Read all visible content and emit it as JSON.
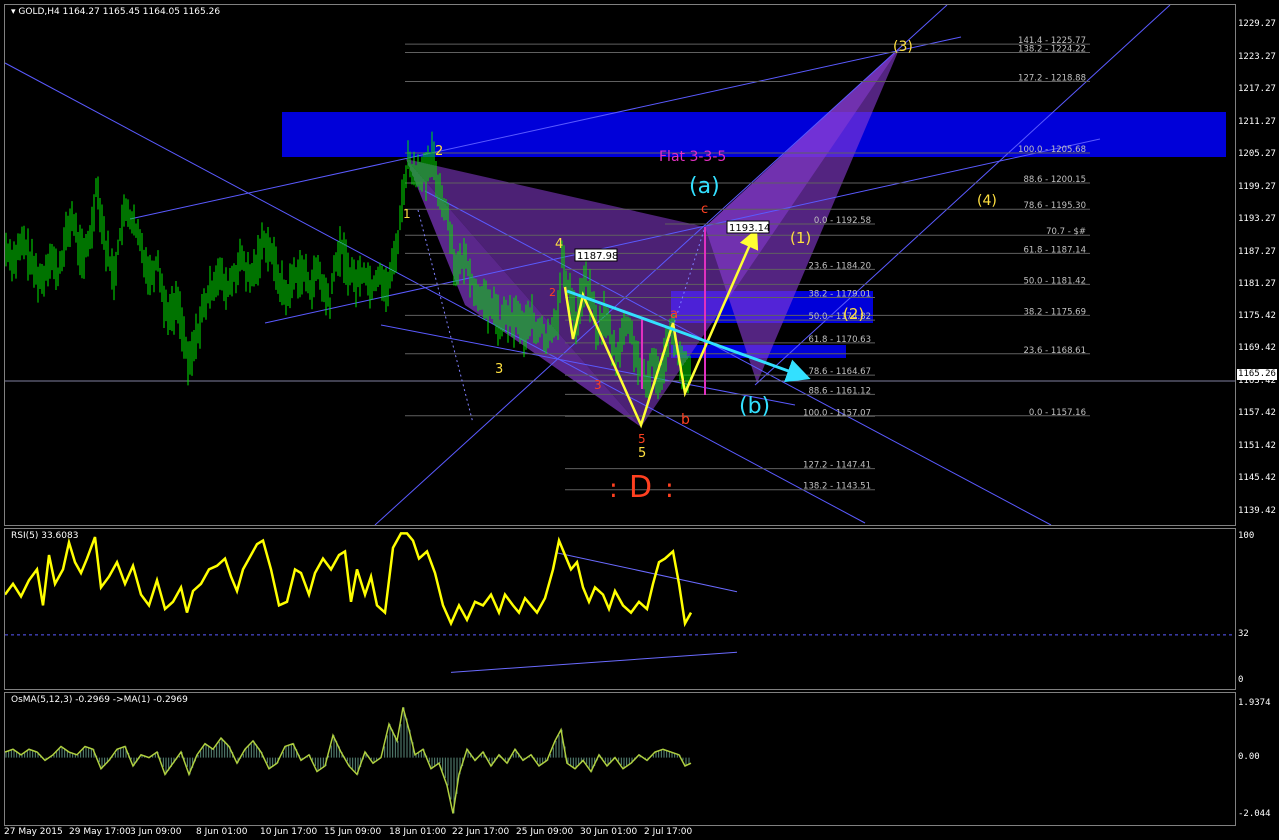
{
  "symbol_header": "GOLD,H4  1164.27 1165.45 1164.05 1165.26",
  "rsi_header": "RSI(5) 33.6083",
  "osma_header": "OsMA(5,12,3) -0.2969  ->MA(1) -0.2969",
  "current_price": "1165.26",
  "chart_data": [
    {
      "type": "candlestick",
      "title": "GOLD,H4",
      "ylim": [
        1137,
        1233
      ],
      "y_ticks": [
        "1229.27",
        "1223.27",
        "1217.27",
        "1211.27",
        "1205.27",
        "1199.27",
        "1193.27",
        "1187.27",
        "1181.27",
        "1175.42",
        "1169.42",
        "1163.42",
        "1157.42",
        "1151.42",
        "1145.42",
        "1139.42"
      ],
      "x_ticks": [
        "27 May 2015",
        "29 May 17:00",
        "3 Jun 09:00",
        "8 Jun 01:00",
        "10 Jun 17:00",
        "15 Jun 09:00",
        "18 Jun 01:00",
        "22 Jun 17:00",
        "25 Jun 09:00",
        "30 Jun 01:00",
        "2 Jul 17:00"
      ],
      "close_path": [
        [
          0,
          1188
        ],
        [
          8,
          1186
        ],
        [
          18,
          1189
        ],
        [
          28,
          1184
        ],
        [
          36,
          1182
        ],
        [
          44,
          1187
        ],
        [
          52,
          1183
        ],
        [
          60,
          1190
        ],
        [
          66,
          1194
        ],
        [
          72,
          1189
        ],
        [
          78,
          1186
        ],
        [
          86,
          1192
        ],
        [
          90,
          1200
        ],
        [
          94,
          1196
        ],
        [
          100,
          1188
        ],
        [
          108,
          1183
        ],
        [
          116,
          1193
        ],
        [
          122,
          1195
        ],
        [
          128,
          1192
        ],
        [
          136,
          1188
        ],
        [
          144,
          1183
        ],
        [
          152,
          1186
        ],
        [
          158,
          1178
        ],
        [
          164,
          1176
        ],
        [
          172,
          1178
        ],
        [
          178,
          1172
        ],
        [
          182,
          1166
        ],
        [
          188,
          1170
        ],
        [
          196,
          1176
        ],
        [
          204,
          1180
        ],
        [
          212,
          1184
        ],
        [
          220,
          1180
        ],
        [
          228,
          1183
        ],
        [
          236,
          1186
        ],
        [
          244,
          1182
        ],
        [
          252,
          1186
        ],
        [
          258,
          1190
        ],
        [
          264,
          1188
        ],
        [
          272,
          1183
        ],
        [
          280,
          1179
        ],
        [
          288,
          1183
        ],
        [
          296,
          1184
        ],
        [
          304,
          1181
        ],
        [
          312,
          1184
        ],
        [
          318,
          1180
        ],
        [
          324,
          1178
        ],
        [
          330,
          1186
        ],
        [
          336,
          1188
        ],
        [
          342,
          1184
        ],
        [
          350,
          1182
        ],
        [
          358,
          1184
        ],
        [
          366,
          1181
        ],
        [
          374,
          1184
        ],
        [
          380,
          1180
        ],
        [
          386,
          1184
        ],
        [
          392,
          1190
        ],
        [
          398,
          1200
        ],
        [
          402,
          1204
        ],
        [
          408,
          1202
        ],
        [
          414,
          1203
        ],
        [
          420,
          1201
        ],
        [
          426,
          1205
        ],
        [
          432,
          1200
        ],
        [
          438,
          1196
        ],
        [
          444,
          1192
        ],
        [
          448,
          1186
        ],
        [
          452,
          1184
        ],
        [
          458,
          1186
        ],
        [
          464,
          1184
        ],
        [
          470,
          1179
        ],
        [
          476,
          1180
        ],
        [
          482,
          1176
        ],
        [
          488,
          1178
        ],
        [
          494,
          1173
        ],
        [
          500,
          1176
        ],
        [
          506,
          1174
        ],
        [
          512,
          1176
        ],
        [
          518,
          1172
        ],
        [
          524,
          1176
        ],
        [
          530,
          1172
        ],
        [
          536,
          1174
        ],
        [
          540,
          1170
        ],
        [
          546,
          1174
        ],
        [
          552,
          1176
        ],
        [
          556,
          1186
        ],
        [
          560,
          1182
        ],
        [
          566,
          1179
        ],
        [
          570,
          1174
        ],
        [
          576,
          1180
        ],
        [
          580,
          1182
        ],
        [
          586,
          1178
        ],
        [
          592,
          1172
        ],
        [
          598,
          1176
        ],
        [
          604,
          1172
        ],
        [
          610,
          1168
        ],
        [
          616,
          1172
        ],
        [
          622,
          1174
        ],
        [
          628,
          1170
        ],
        [
          634,
          1166
        ],
        [
          640,
          1162
        ],
        [
          646,
          1168
        ],
        [
          652,
          1164
        ],
        [
          658,
          1168
        ],
        [
          664,
          1174
        ],
        [
          670,
          1170
        ],
        [
          676,
          1166
        ],
        [
          682,
          1164
        ],
        [
          686,
          1166
        ]
      ],
      "fibonacci_levels": [
        "141.4 - 1225.77",
        "138.2 - 1224.22",
        "127.2 - 1218.88",
        "100.0 - 1205.68",
        "88.6 - 1200.15",
        "78.6 - 1195.30",
        "0.0 - 1192.58",
        "70.7 - $#",
        "61.8 - 1187.14",
        "23.6 - 1184.20",
        "50.0 - 1181.42",
        "38.2 - 1179.01",
        "38.2 - 1175.69",
        "50.0 - 1174.82",
        "61.8 - 1170.63",
        "23.6 - 1168.61",
        "78.6 - 1164.67",
        "88.6 - 1161.12",
        "100.0 - 1157.07",
        "0.0 - 1157.16",
        "127.2 - 1147.41",
        "138.2 - 1143.51"
      ],
      "annotations": [
        "(3)",
        "2",
        "Flat 3-3-5",
        "(a)",
        "c",
        "1193.14",
        "(1)",
        "(4)",
        "4",
        "1187.98",
        "1",
        "2",
        "a",
        "(2)",
        "3",
        "3",
        "(b)",
        "b",
        "5",
        "5",
        ":",
        "D",
        ":"
      ]
    },
    {
      "type": "line",
      "title": "RSI(5) 33.6083",
      "ylim": [
        0,
        100
      ],
      "y_ticks": [
        "100",
        "32",
        "0"
      ],
      "level": 32,
      "values_path": [
        [
          0,
          66
        ],
        [
          8,
          72
        ],
        [
          16,
          65
        ],
        [
          24,
          74
        ],
        [
          32,
          80
        ],
        [
          38,
          60
        ],
        [
          44,
          88
        ],
        [
          50,
          72
        ],
        [
          58,
          80
        ],
        [
          64,
          95
        ],
        [
          70,
          84
        ],
        [
          76,
          78
        ],
        [
          82,
          86
        ],
        [
          90,
          98
        ],
        [
          96,
          70
        ],
        [
          104,
          76
        ],
        [
          112,
          84
        ],
        [
          120,
          72
        ],
        [
          128,
          82
        ],
        [
          136,
          66
        ],
        [
          144,
          60
        ],
        [
          152,
          74
        ],
        [
          160,
          58
        ],
        [
          168,
          62
        ],
        [
          176,
          70
        ],
        [
          182,
          56
        ],
        [
          188,
          68
        ],
        [
          196,
          72
        ],
        [
          204,
          80
        ],
        [
          212,
          82
        ],
        [
          220,
          86
        ],
        [
          226,
          76
        ],
        [
          232,
          68
        ],
        [
          238,
          80
        ],
        [
          244,
          86
        ],
        [
          252,
          94
        ],
        [
          258,
          96
        ],
        [
          266,
          80
        ],
        [
          274,
          60
        ],
        [
          282,
          62
        ],
        [
          290,
          80
        ],
        [
          296,
          78
        ],
        [
          304,
          66
        ],
        [
          310,
          78
        ],
        [
          318,
          86
        ],
        [
          326,
          80
        ],
        [
          334,
          88
        ],
        [
          340,
          90
        ],
        [
          346,
          62
        ],
        [
          352,
          80
        ],
        [
          360,
          66
        ],
        [
          366,
          76
        ],
        [
          372,
          60
        ],
        [
          380,
          56
        ],
        [
          388,
          92
        ],
        [
          396,
          100
        ],
        [
          402,
          100
        ],
        [
          408,
          96
        ],
        [
          414,
          86
        ],
        [
          422,
          90
        ],
        [
          430,
          78
        ],
        [
          438,
          60
        ],
        [
          446,
          50
        ],
        [
          454,
          60
        ],
        [
          462,
          52
        ],
        [
          470,
          62
        ],
        [
          478,
          60
        ],
        [
          486,
          66
        ],
        [
          494,
          56
        ],
        [
          500,
          66
        ],
        [
          508,
          60
        ],
        [
          514,
          56
        ],
        [
          520,
          64
        ],
        [
          526,
          60
        ],
        [
          532,
          56
        ],
        [
          540,
          64
        ],
        [
          548,
          80
        ],
        [
          554,
          96
        ],
        [
          560,
          88
        ],
        [
          566,
          80
        ],
        [
          572,
          84
        ],
        [
          578,
          70
        ],
        [
          584,
          62
        ],
        [
          590,
          70
        ],
        [
          598,
          66
        ],
        [
          604,
          58
        ],
        [
          610,
          68
        ],
        [
          618,
          60
        ],
        [
          626,
          56
        ],
        [
          634,
          62
        ],
        [
          642,
          58
        ],
        [
          648,
          72
        ],
        [
          654,
          84
        ],
        [
          660,
          86
        ],
        [
          668,
          90
        ],
        [
          674,
          72
        ],
        [
          680,
          50
        ],
        [
          686,
          56
        ]
      ]
    },
    {
      "type": "bar",
      "title": "OsMA(5,12,3) -0.2969  ->MA(1) -0.2969",
      "ylim": [
        -2.2,
        2.1
      ],
      "y_ticks": [
        "1.9374",
        "0.00",
        "-2.044"
      ],
      "values_path": [
        [
          0,
          0.2
        ],
        [
          8,
          0.3
        ],
        [
          16,
          0.1
        ],
        [
          24,
          0.3
        ],
        [
          32,
          0.2
        ],
        [
          40,
          -0.1
        ],
        [
          48,
          0.1
        ],
        [
          56,
          0.4
        ],
        [
          64,
          0.2
        ],
        [
          72,
          0.1
        ],
        [
          80,
          0.4
        ],
        [
          88,
          0.3
        ],
        [
          96,
          -0.4
        ],
        [
          104,
          -0.1
        ],
        [
          112,
          0.3
        ],
        [
          120,
          0.4
        ],
        [
          128,
          -0.3
        ],
        [
          136,
          0.1
        ],
        [
          144,
          0.0
        ],
        [
          152,
          0.2
        ],
        [
          160,
          -0.6
        ],
        [
          168,
          -0.2
        ],
        [
          176,
          0.2
        ],
        [
          184,
          -0.6
        ],
        [
          192,
          0.1
        ],
        [
          200,
          0.5
        ],
        [
          208,
          0.3
        ],
        [
          216,
          0.7
        ],
        [
          224,
          0.4
        ],
        [
          232,
          -0.2
        ],
        [
          240,
          0.3
        ],
        [
          248,
          0.6
        ],
        [
          256,
          0.2
        ],
        [
          264,
          -0.4
        ],
        [
          272,
          -0.2
        ],
        [
          280,
          0.4
        ],
        [
          288,
          0.5
        ],
        [
          296,
          -0.1
        ],
        [
          304,
          0.1
        ],
        [
          312,
          -0.5
        ],
        [
          320,
          -0.3
        ],
        [
          328,
          0.8
        ],
        [
          336,
          0.2
        ],
        [
          344,
          -0.3
        ],
        [
          352,
          -0.6
        ],
        [
          360,
          0.2
        ],
        [
          368,
          -0.2
        ],
        [
          376,
          0.0
        ],
        [
          384,
          1.2
        ],
        [
          392,
          0.6
        ],
        [
          398,
          1.8
        ],
        [
          404,
          1.0
        ],
        [
          410,
          0.1
        ],
        [
          418,
          0.3
        ],
        [
          426,
          -0.4
        ],
        [
          434,
          -0.2
        ],
        [
          442,
          -1.0
        ],
        [
          448,
          -2.0
        ],
        [
          454,
          -0.6
        ],
        [
          462,
          0.3
        ],
        [
          470,
          -0.1
        ],
        [
          478,
          0.2
        ],
        [
          486,
          -0.3
        ],
        [
          494,
          0.1
        ],
        [
          502,
          -0.2
        ],
        [
          510,
          0.3
        ],
        [
          518,
          -0.1
        ],
        [
          526,
          0.1
        ],
        [
          534,
          -0.3
        ],
        [
          542,
          -0.1
        ],
        [
          550,
          0.6
        ],
        [
          556,
          1.0
        ],
        [
          562,
          -0.2
        ],
        [
          570,
          -0.4
        ],
        [
          578,
          -0.1
        ],
        [
          586,
          -0.5
        ],
        [
          594,
          0.1
        ],
        [
          602,
          -0.3
        ],
        [
          610,
          0.0
        ],
        [
          618,
          -0.4
        ],
        [
          626,
          -0.2
        ],
        [
          634,
          0.1
        ],
        [
          642,
          -0.1
        ],
        [
          650,
          0.2
        ],
        [
          658,
          0.3
        ],
        [
          666,
          0.2
        ],
        [
          674,
          0.1
        ],
        [
          680,
          -0.3
        ],
        [
          686,
          -0.2
        ]
      ]
    }
  ],
  "colors": {
    "candle": "#00e600",
    "trendline": "#5a5aff",
    "pattern_fill": "#8a3cd6",
    "zone": "#0000ff",
    "rsi": "#ffff00",
    "osma_line": "#b0d040",
    "osma_hist": "#5a8a7a",
    "fib_text": "#c0c0c0",
    "arrow_yellow": "#ffff33",
    "arrow_cyan": "#33e0ff",
    "label_red": "#ff4020",
    "label_yellow": "#ffe040",
    "label_magenta": "#e030c0"
  }
}
